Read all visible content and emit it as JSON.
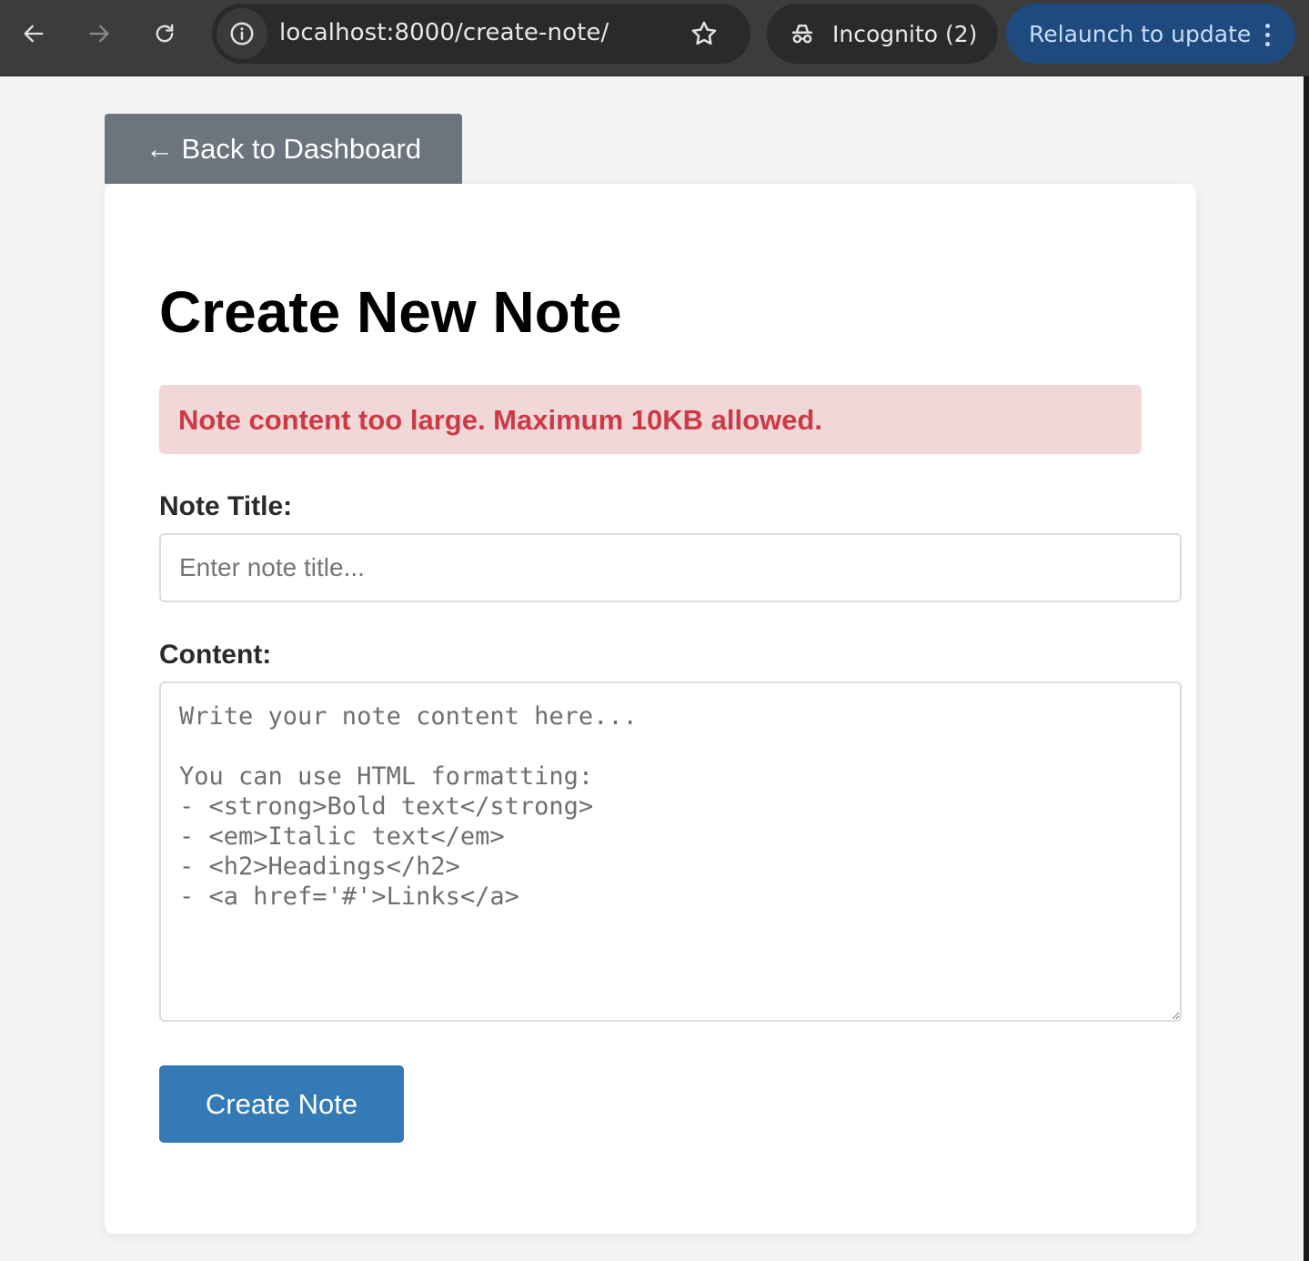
{
  "browser": {
    "url": "localhost:8000/create-note/",
    "incognito_label": "Incognito (2)",
    "relaunch_label": "Relaunch to update",
    "icons": [
      "back-arrow-icon",
      "forward-arrow-icon",
      "reload-icon",
      "site-info-icon",
      "bookmark-star-icon",
      "incognito-icon",
      "more-options-icon"
    ]
  },
  "nav": {
    "back_label": "← Back to Dashboard"
  },
  "page": {
    "title": "Create New Note",
    "error_message": "Note content too large. Maximum 10KB allowed."
  },
  "form": {
    "title_label": "Note Title:",
    "title_value": "",
    "title_placeholder": "Enter note title...",
    "content_label": "Content:",
    "content_value": "",
    "content_placeholder": "Write your note content here...\n\nYou can use HTML formatting:\n- <strong>Bold text</strong>\n- <em>Italic text</em>\n- <h2>Headings</h2>\n- <a href='#'>Links</a>",
    "submit_label": "Create Note"
  },
  "colors": {
    "chrome_bg": "#3c3c3c",
    "back_button_bg": "#6c757d",
    "alert_bg": "#f2d7d9",
    "alert_text": "#cc3a45",
    "submit_bg": "#337ab7",
    "relaunch_bg": "#1e4a7e"
  }
}
